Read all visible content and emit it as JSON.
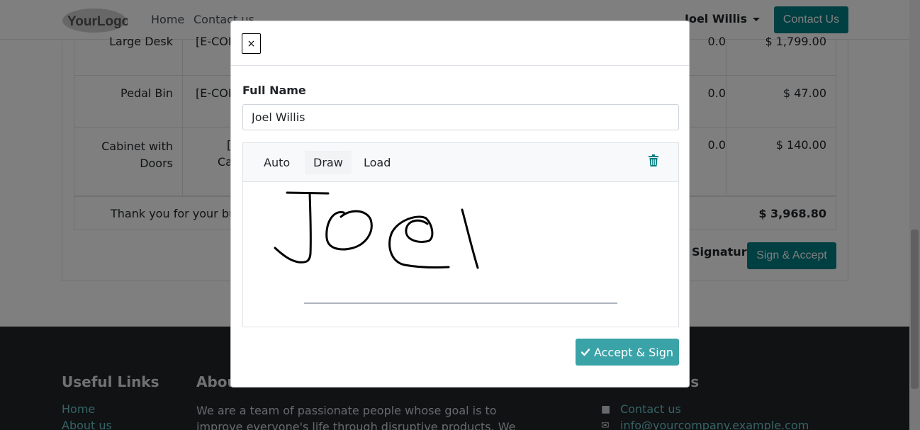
{
  "navbar": {
    "logo_text": "YourLogo",
    "home": "Home",
    "contact": "Contact us",
    "user": "Joel Willis",
    "cta": "Contact Us"
  },
  "order_lines": [
    {
      "name": "Large Desk",
      "desc": "[E-COM",
      "disc": "0.0",
      "price": "$ 1,799.00"
    },
    {
      "name": "Pedal Bin",
      "desc": "[E-COM",
      "disc": "0.0",
      "price": "$ 47.00"
    },
    {
      "name": "Cabinet with Doors",
      "desc": "[",
      "desc2": "Ca",
      "disc": "0.0",
      "price": "$ 140.00"
    }
  ],
  "order": {
    "thanks": "Thank you for your busi",
    "total": "$ 3,968.80",
    "signature_label": "Signature:",
    "sign_accept": "Sign & Accept"
  },
  "footer": {
    "useful_links": "Useful Links",
    "home": "Home",
    "about_us": "About us",
    "about_title": "Abou",
    "about_text": "We are a team of passionate people whose goal is to improve everyone's life through disruptive products. We build great",
    "contact_title": "us",
    "contact_us": "Contact us",
    "email": "info@yourcompany.example.com"
  },
  "modal": {
    "close": "×",
    "full_name_label": "Full Name",
    "full_name_value": "Joel Willis",
    "tabs": [
      "Auto",
      "Draw",
      "Load"
    ],
    "active_tab": "Draw",
    "accept_button": "Accept & Sign"
  },
  "colors": {
    "primary": "#017e84",
    "accept": "#3aa3a8",
    "footer_bg": "#212529"
  }
}
